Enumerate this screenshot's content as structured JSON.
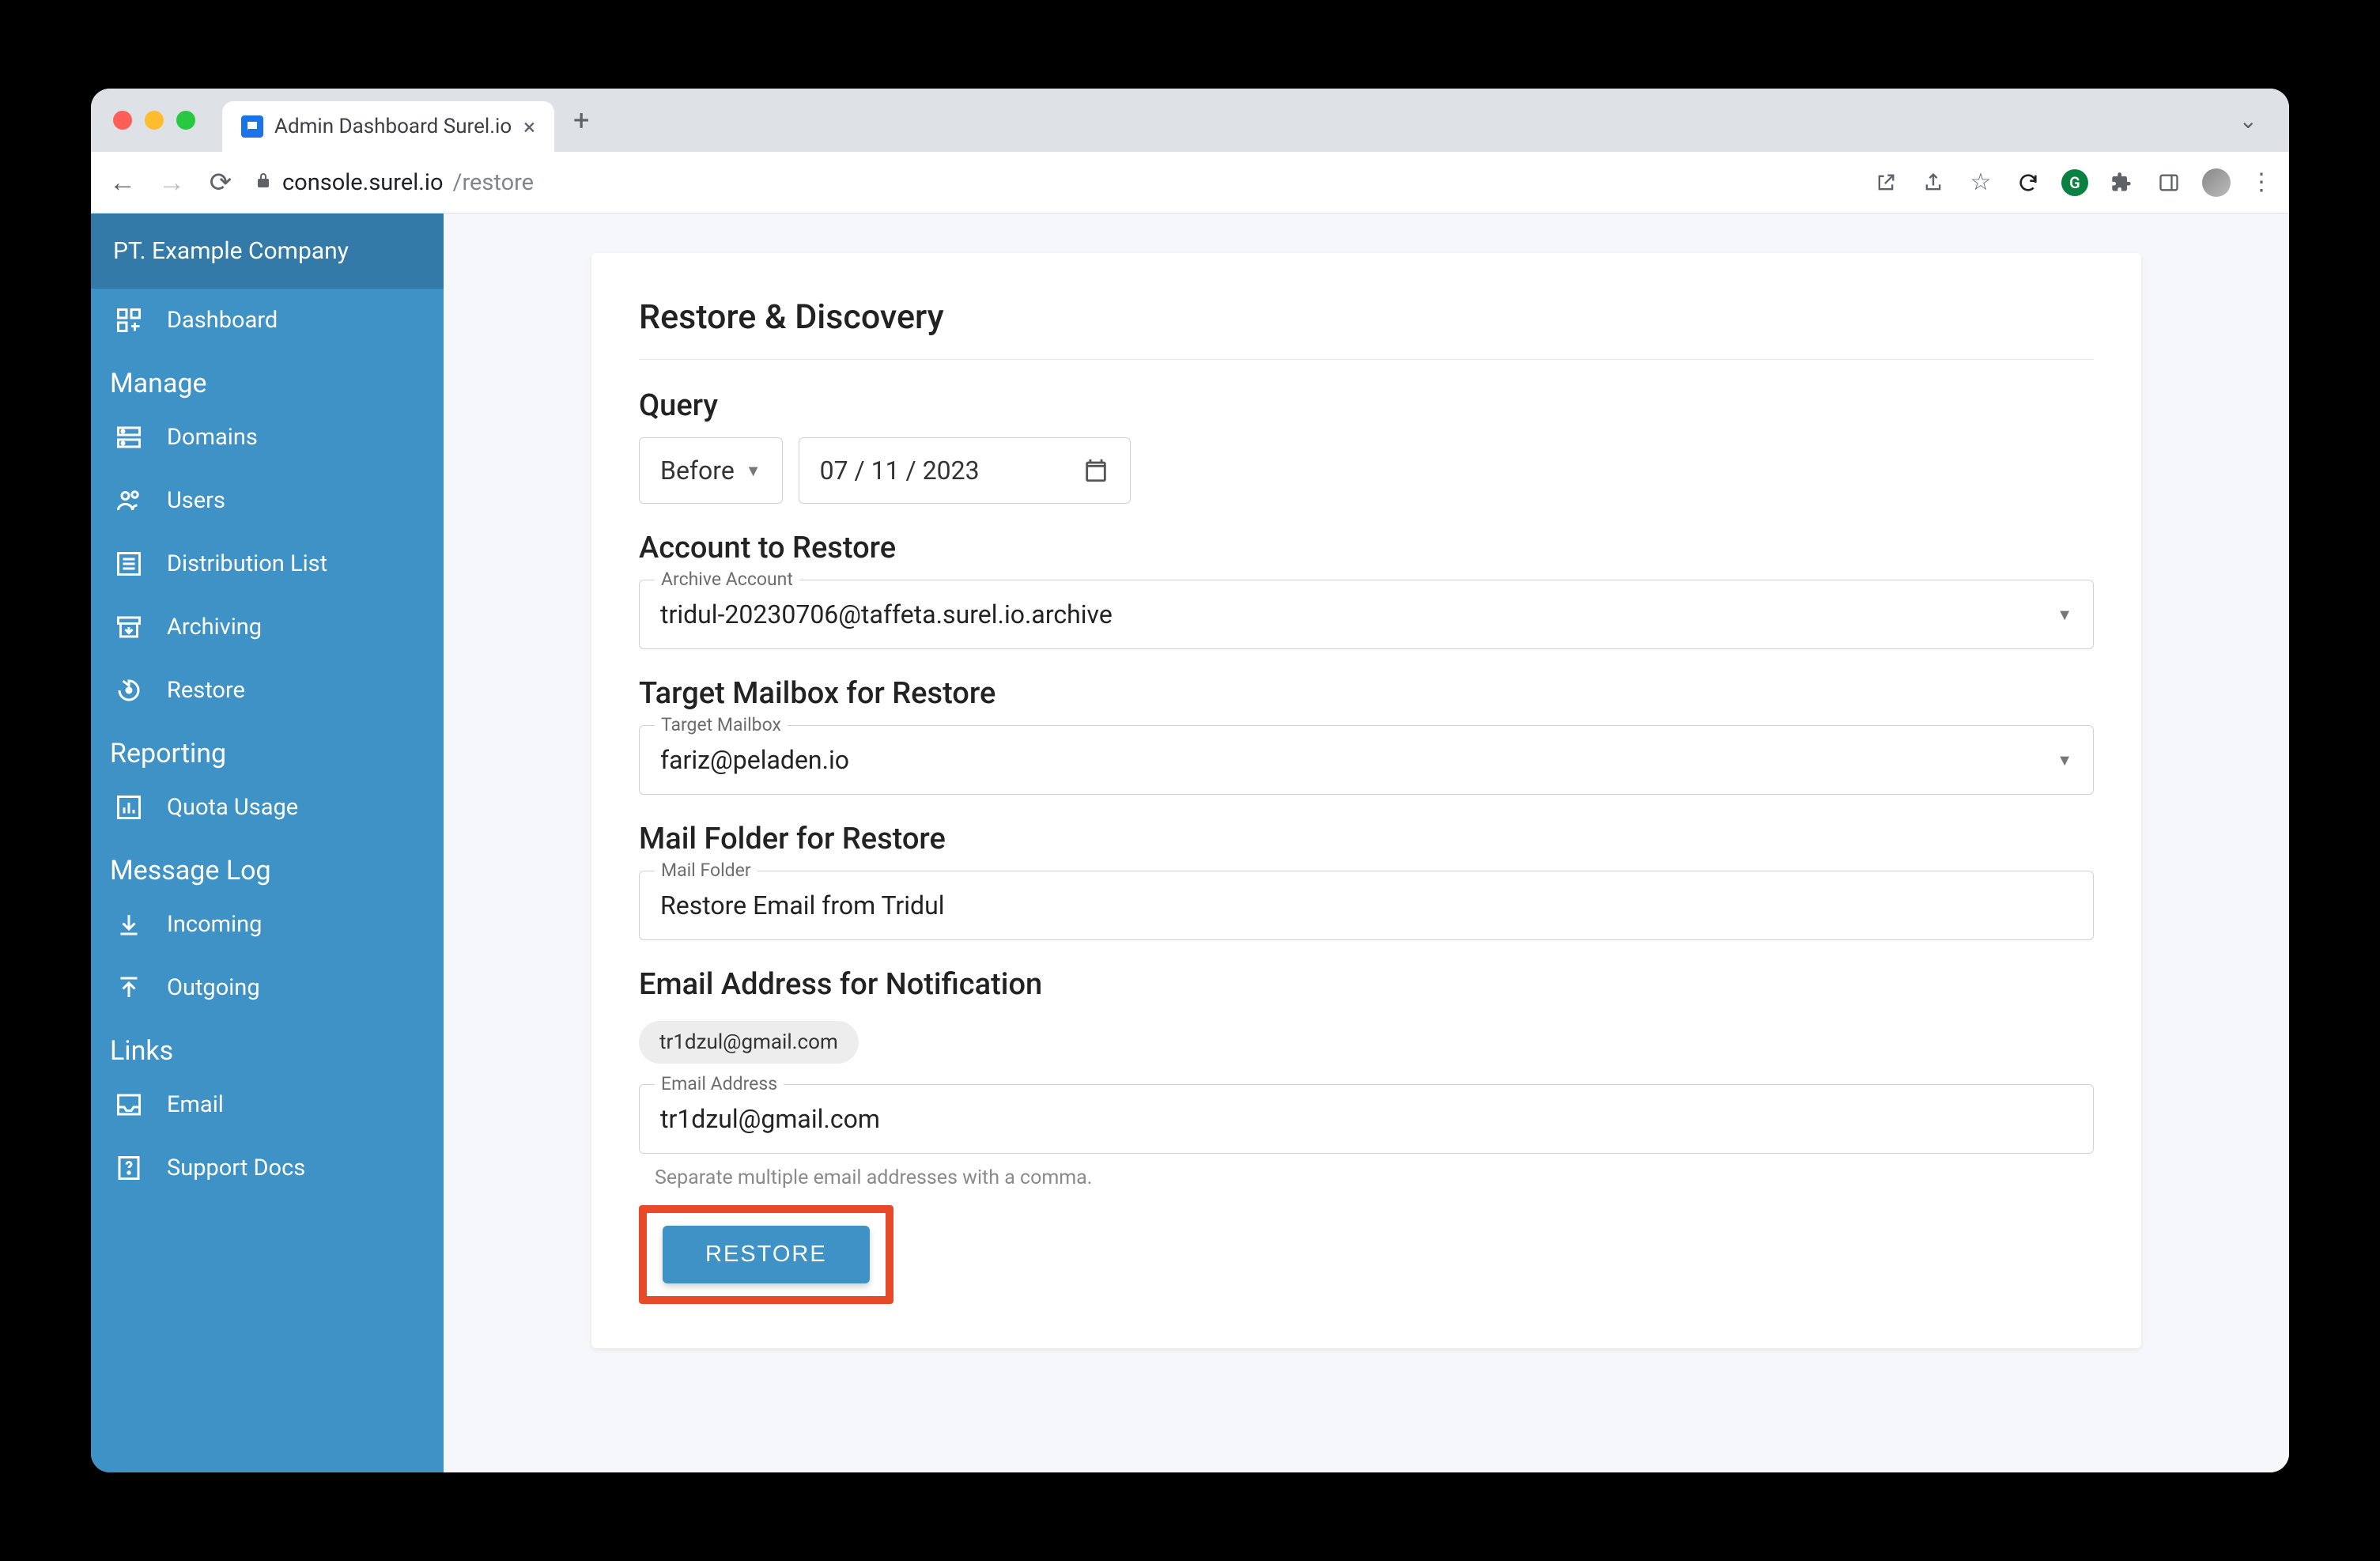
{
  "browser": {
    "tab_title": "Admin Dashboard Surel.io",
    "url_host": "console.surel.io",
    "url_path": "/restore"
  },
  "sidebar": {
    "org": "PT. Example Company",
    "dashboard": "Dashboard",
    "sections": {
      "manage": "Manage",
      "reporting": "Reporting",
      "msglog": "Message Log",
      "links": "Links"
    },
    "items": {
      "domains": "Domains",
      "users": "Users",
      "distlist": "Distribution List",
      "archiving": "Archiving",
      "restore": "Restore",
      "quota": "Quota Usage",
      "incoming": "Incoming",
      "outgoing": "Outgoing",
      "email": "Email",
      "support": "Support Docs"
    }
  },
  "page": {
    "title": "Restore & Discovery",
    "query_heading": "Query",
    "query_mode": "Before",
    "query_date": "07 / 11 / 2023",
    "account_heading": "Account to Restore",
    "account_label": "Archive Account",
    "account_value": "tridul-20230706@taffeta.surel.io.archive",
    "target_heading": "Target Mailbox for Restore",
    "target_label": "Target Mailbox",
    "target_value": "fariz@peladen.io",
    "folder_heading": "Mail Folder for Restore",
    "folder_label": "Mail Folder",
    "folder_value": "Restore Email from Tridul",
    "notif_heading": "Email Address for Notification",
    "notif_chip": "tr1dzul@gmail.com",
    "notif_label": "Email Address",
    "notif_value": "tr1dzul@gmail.com",
    "notif_hint": "Separate multiple email addresses with a comma.",
    "restore_button": "RESTORE"
  }
}
